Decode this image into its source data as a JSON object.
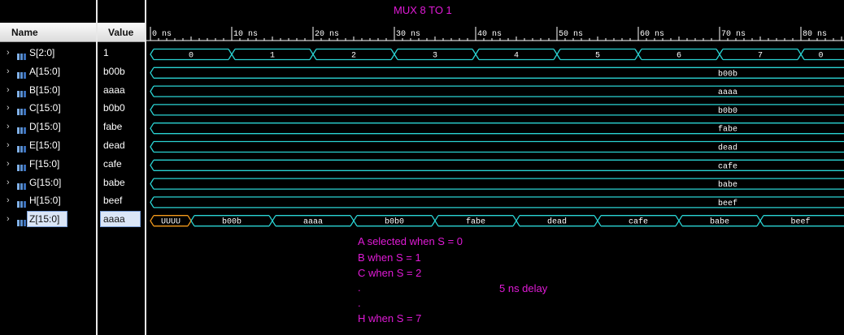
{
  "title": "MUX 8 TO 1",
  "columns": {
    "name": "Name",
    "value": "Value"
  },
  "time_ticks": [
    "0 ns",
    "10 ns",
    "20 ns",
    "30 ns",
    "40 ns",
    "50 ns",
    "60 ns",
    "70 ns",
    "80 ns"
  ],
  "signals": [
    {
      "name": "S[2:0]",
      "value": "1",
      "kind": "bus",
      "segments": [
        {
          "t": 0,
          "v": "0"
        },
        {
          "t": 10,
          "v": "1"
        },
        {
          "t": 20,
          "v": "2"
        },
        {
          "t": 30,
          "v": "3"
        },
        {
          "t": 40,
          "v": "4"
        },
        {
          "t": 50,
          "v": "5"
        },
        {
          "t": 60,
          "v": "6"
        },
        {
          "t": 70,
          "v": "7"
        },
        {
          "t": 80,
          "v": "0"
        }
      ]
    },
    {
      "name": "A[15:0]",
      "value": "b00b",
      "kind": "bus",
      "segments": [
        {
          "t": 0,
          "v": "b00b"
        }
      ]
    },
    {
      "name": "B[15:0]",
      "value": "aaaa",
      "kind": "bus",
      "segments": [
        {
          "t": 0,
          "v": "aaaa"
        }
      ]
    },
    {
      "name": "C[15:0]",
      "value": "b0b0",
      "kind": "bus",
      "segments": [
        {
          "t": 0,
          "v": "b0b0"
        }
      ]
    },
    {
      "name": "D[15:0]",
      "value": "fabe",
      "kind": "bus",
      "segments": [
        {
          "t": 0,
          "v": "fabe"
        }
      ]
    },
    {
      "name": "E[15:0]",
      "value": "dead",
      "kind": "bus",
      "segments": [
        {
          "t": 0,
          "v": "dead"
        }
      ]
    },
    {
      "name": "F[15:0]",
      "value": "cafe",
      "kind": "bus",
      "segments": [
        {
          "t": 0,
          "v": "cafe"
        }
      ]
    },
    {
      "name": "G[15:0]",
      "value": "babe",
      "kind": "bus",
      "segments": [
        {
          "t": 0,
          "v": "babe"
        }
      ]
    },
    {
      "name": "H[15:0]",
      "value": "beef",
      "kind": "bus",
      "segments": [
        {
          "t": 0,
          "v": "beef"
        }
      ]
    },
    {
      "name": "Z[15:0]",
      "value": "aaaa",
      "kind": "bus",
      "selected": true,
      "segments": [
        {
          "t": 0,
          "v": "UUUU",
          "undefined": true
        },
        {
          "t": 5,
          "v": "b00b"
        },
        {
          "t": 15,
          "v": "aaaa"
        },
        {
          "t": 25,
          "v": "b0b0"
        },
        {
          "t": 35,
          "v": "fabe"
        },
        {
          "t": 45,
          "v": "dead"
        },
        {
          "t": 55,
          "v": "cafe"
        },
        {
          "t": 65,
          "v": "babe"
        },
        {
          "t": 75,
          "v": "beef"
        }
      ]
    }
  ],
  "annotations": {
    "line1": "A selected when S = 0",
    "line2": "B when S = 1",
    "line3": "C when S = 2",
    "dot1": ".",
    "delay": "5 ns delay",
    "dot2": ".",
    "line4": "H when S = 7"
  },
  "colors": {
    "wave": "#2ad3d3",
    "undefined": "#f39a1c",
    "annotation": "#e01ad6"
  }
}
